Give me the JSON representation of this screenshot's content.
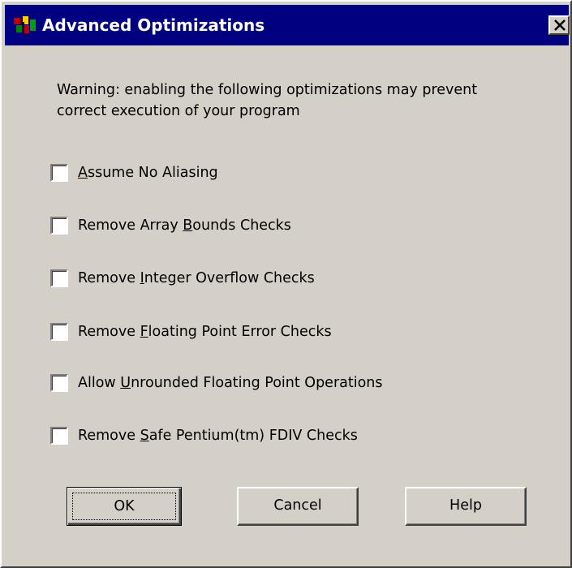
{
  "window": {
    "title": "Advanced Optimizations",
    "app_icon": "app-icon",
    "close_icon": "close-icon"
  },
  "warning": {
    "line1": "Warning: enabling the following optimizations may prevent",
    "line2": "correct execution of your program"
  },
  "options": [
    {
      "pre": "",
      "mnemonic": "A",
      "post": "ssume No Aliasing",
      "checked": false
    },
    {
      "pre": "Remove Array ",
      "mnemonic": "B",
      "post": "ounds Checks",
      "checked": false
    },
    {
      "pre": "Remove ",
      "mnemonic": "I",
      "post": "nteger Overflow Checks",
      "checked": false
    },
    {
      "pre": "Remove ",
      "mnemonic": "F",
      "post": "loating Point Error Checks",
      "checked": false
    },
    {
      "pre": "Allow ",
      "mnemonic": "U",
      "post": "nrounded Floating Point Operations",
      "checked": false
    },
    {
      "pre": "Remove ",
      "mnemonic": "S",
      "post": "afe Pentium(tm) FDIV Checks",
      "checked": false
    }
  ],
  "buttons": {
    "ok": "OK",
    "cancel": "Cancel",
    "help": "Help"
  },
  "colors": {
    "titlebar": "#000080",
    "face": "#d4d0c8"
  }
}
